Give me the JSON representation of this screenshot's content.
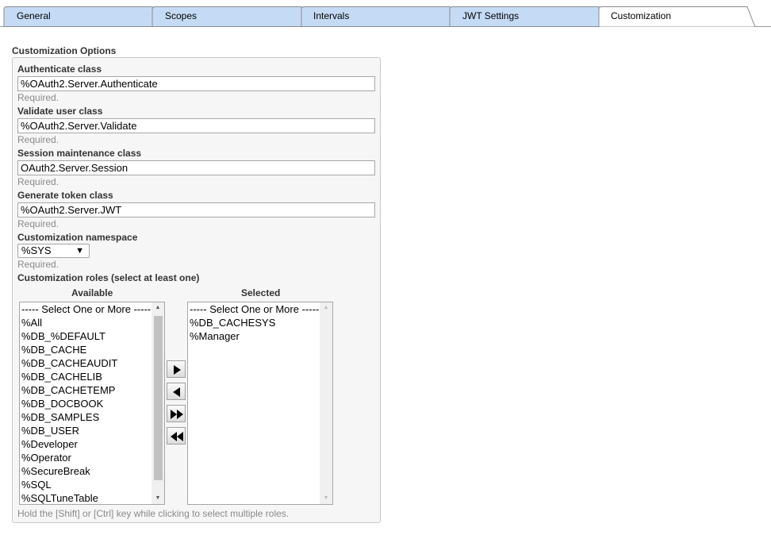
{
  "tabs": [
    {
      "label": "General",
      "active": false
    },
    {
      "label": "Scopes",
      "active": false
    },
    {
      "label": "Intervals",
      "active": false
    },
    {
      "label": "JWT Settings",
      "active": false
    },
    {
      "label": "Customization",
      "active": true
    }
  ],
  "colors": {
    "tab_inactive": "#c5dbf5",
    "tab_active": "#ffffff",
    "panel_bg": "#f6f6f6",
    "hint": "#8a8a8a"
  },
  "section": {
    "title": "Customization Options"
  },
  "fields": {
    "authenticate": {
      "label": "Authenticate class",
      "value": "%OAuth2.Server.Authenticate",
      "hint": "Required."
    },
    "validate": {
      "label": "Validate user class",
      "value": "%OAuth2.Server.Validate",
      "hint": "Required."
    },
    "session": {
      "label": "Session maintenance class",
      "value": "OAuth2.Server.Session",
      "hint": "Required."
    },
    "token": {
      "label": "Generate token class",
      "value": "%OAuth2.Server.JWT",
      "hint": "Required."
    },
    "namespace": {
      "label": "Customization namespace",
      "value": "%SYS",
      "hint": "Required."
    }
  },
  "roles": {
    "label": "Customization roles (select at least one)",
    "available_label": "Available",
    "selected_label": "Selected",
    "available": [
      "----- Select One or More -----",
      "%All",
      "%DB_%DEFAULT",
      "%DB_CACHE",
      "%DB_CACHEAUDIT",
      "%DB_CACHELIB",
      "%DB_CACHETEMP",
      "%DB_DOCBOOK",
      "%DB_SAMPLES",
      "%DB_USER",
      "%Developer",
      "%Operator",
      "%SecureBreak",
      "%SQL",
      "%SQLTuneTable"
    ],
    "selected": [
      "----- Select One or More -----",
      "%DB_CACHESYS",
      "%Manager"
    ],
    "buttons": [
      "move-right",
      "move-left",
      "move-all-right",
      "move-all-left"
    ],
    "footnote": "Hold the [Shift] or [Ctrl] key while clicking to select multiple roles."
  }
}
